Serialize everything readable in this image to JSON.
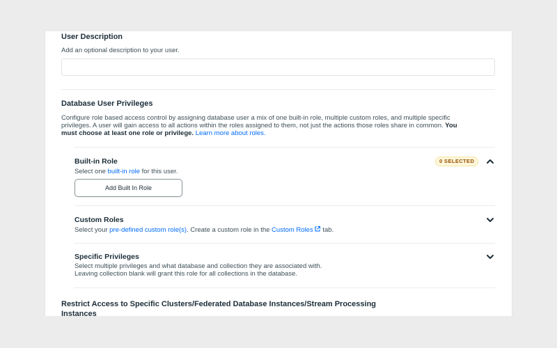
{
  "user_description": {
    "title": "User Description",
    "helper": "Add an optional description to your user.",
    "value": "",
    "placeholder": ""
  },
  "privileges": {
    "title": "Database User Privileges",
    "intro_line1": "Configure role based access control by assigning database user a mix of one built-in role, multiple custom roles, and multiple specific",
    "intro_line2_a": "privileges. A user will gain access to all actions within the roles assigned to them, not just the actions those roles share in common.",
    "intro_line2_bold": "You",
    "intro_line3_bold": "must choose at least one role or privilege.",
    "intro_link": "Learn more about roles."
  },
  "builtin_role": {
    "title": "Built-in Role",
    "badge": "0 SELECTED",
    "desc_prefix": "Select one",
    "desc_link": "built-in role",
    "desc_suffix": "for this user.",
    "button_label": "Add Built In Role"
  },
  "custom_roles": {
    "title": "Custom Roles",
    "desc_prefix": "Select your",
    "desc_link": "pre-defined custom role(s)",
    "desc_mid": ". Create a custom role in the",
    "desc_link2": "Custom Roles",
    "desc_suffix": "tab."
  },
  "specific_privileges": {
    "title": "Specific Privileges",
    "desc_line1": "Select multiple privileges and what database and collection they are associated with.",
    "desc_line2": "Leaving collection blank will grant this role for all collections in the database."
  },
  "restrict_access": {
    "title_line1": "Restrict Access to Specific Clusters/Federated Database Instances/Stream Processing",
    "title_line2": "Instances"
  },
  "icons": {
    "builtin_toggle": "chevron-up-icon",
    "custom_toggle": "chevron-down-icon",
    "specific_toggle": "chevron-down-icon",
    "external_link": "external-link-icon"
  },
  "colors": {
    "link": "#016bf8",
    "badge_bg": "#fef7db",
    "badge_text": "#944f01"
  }
}
